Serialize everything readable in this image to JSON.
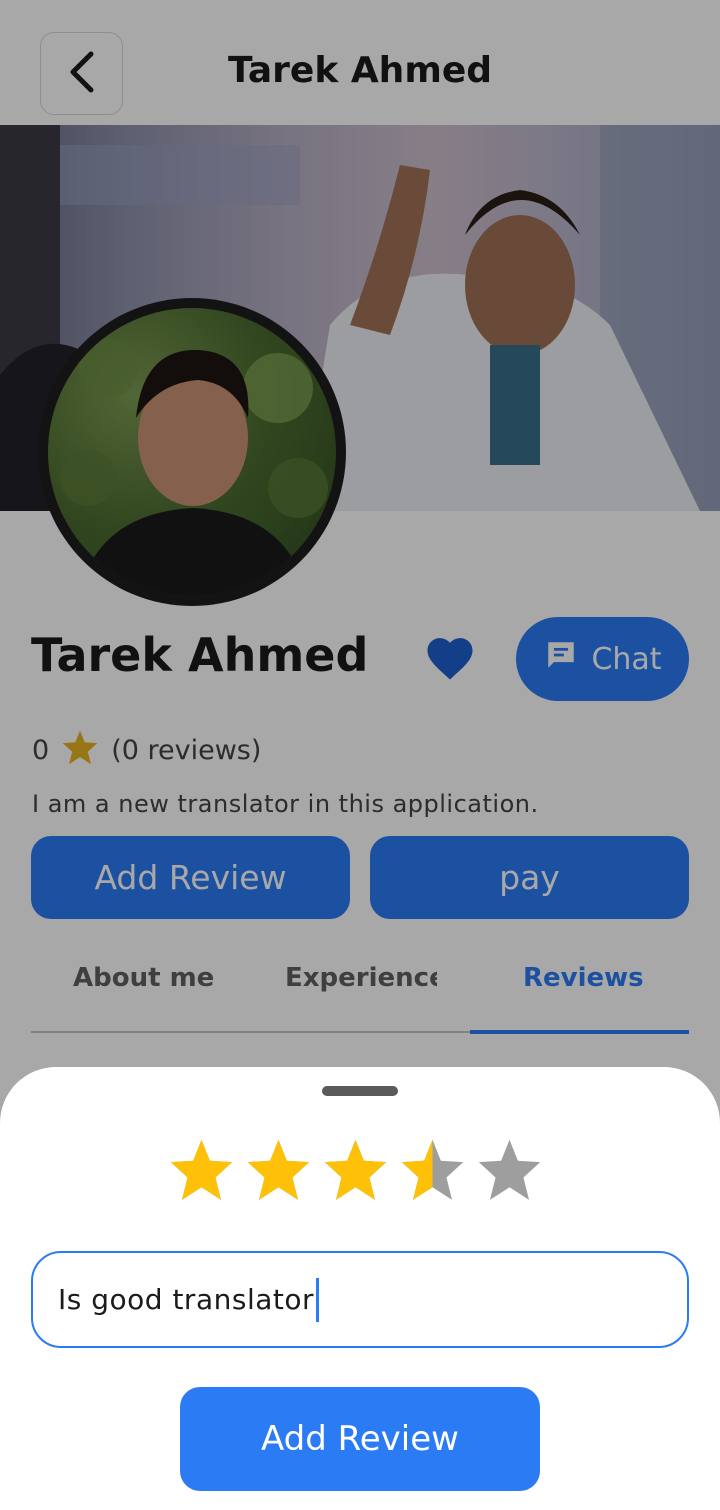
{
  "header": {
    "title": "Tarek Ahmed",
    "back_icon": "chevron-left-icon"
  },
  "profile": {
    "name": "Tarek Ahmed",
    "favorite_icon": "heart-icon",
    "rating_value": "0",
    "rating_icon": "star-icon",
    "reviews_count": "(0 reviews)",
    "bio": "I am a new translator in this application.",
    "chat_label": "Chat",
    "chat_icon": "chat-bubble-icon",
    "add_review_label": "Add Review",
    "pay_label": "pay"
  },
  "tabs": [
    {
      "label": "About me",
      "active": false
    },
    {
      "label": "Experience",
      "active": false
    },
    {
      "label": "Reviews",
      "active": true
    }
  ],
  "review_sheet": {
    "rating": 3.5,
    "max_rating": 5,
    "input_value": "Is good translator",
    "submit_label": "Add Review"
  },
  "colors": {
    "primary": "#2b7bf5",
    "star_filled": "#ffc107",
    "star_empty": "#9e9e9e"
  }
}
